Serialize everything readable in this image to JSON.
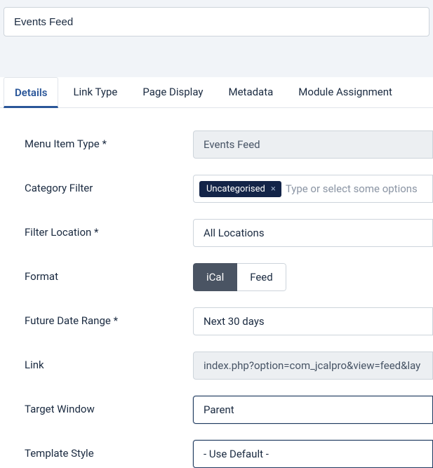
{
  "title": {
    "value": "Events Feed"
  },
  "tabs": [
    {
      "label": "Details"
    },
    {
      "label": "Link Type"
    },
    {
      "label": "Page Display"
    },
    {
      "label": "Metadata"
    },
    {
      "label": "Module Assignment"
    }
  ],
  "fields": {
    "menuItemType": {
      "label": "Menu Item Type *",
      "value": "Events Feed"
    },
    "categoryFilter": {
      "label": "Category Filter",
      "tag": "Uncategorised",
      "placeholder": "Type or select some options"
    },
    "filterLocation": {
      "label": "Filter Location *",
      "value": "All Locations"
    },
    "format": {
      "label": "Format",
      "option1": "iCal",
      "option2": "Feed"
    },
    "futureDateRange": {
      "label": "Future Date Range *",
      "value": "Next 30 days"
    },
    "link": {
      "label": "Link",
      "value": "index.php?option=com_jcalpro&view=feed&lay"
    },
    "targetWindow": {
      "label": "Target Window",
      "value": "Parent"
    },
    "templateStyle": {
      "label": "Template Style",
      "value": "- Use Default -"
    }
  }
}
